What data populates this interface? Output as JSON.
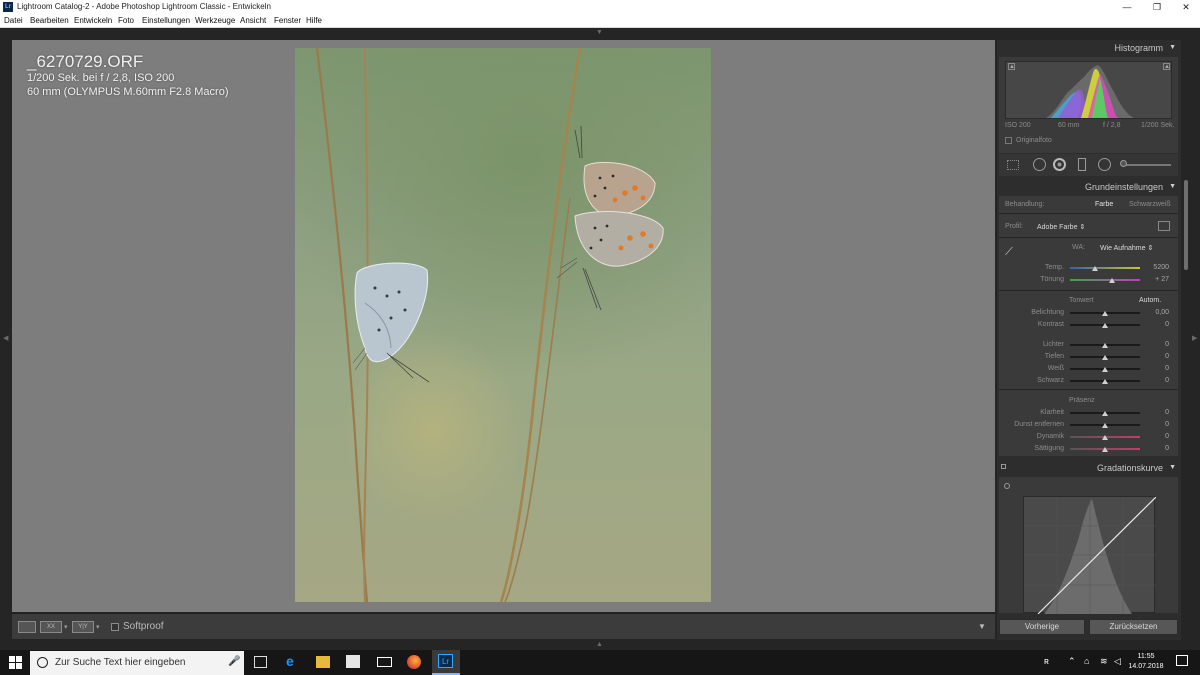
{
  "window": {
    "title": "Lightroom Catalog-2 - Adobe Photoshop Lightroom Classic - Entwickeln",
    "app_badge": "Lr",
    "controls": [
      "—",
      "❐",
      "✕"
    ]
  },
  "menu": [
    "Datei",
    "Bearbeiten",
    "Entwickeln",
    "Foto",
    "Einstellungen",
    "Werkzeuge",
    "Ansicht",
    "Fenster",
    "Hilfe"
  ],
  "photo_info": {
    "filename": "_6270729.ORF",
    "exposure": "1/200 Sek. bei f / 2,8, ISO 200",
    "lens": "60 mm (OLYMPUS M.60mm F2.8 Macro)"
  },
  "toolbar": {
    "view_buttons": [
      "",
      "XX",
      "Y|Y"
    ],
    "softproof_label": "Softproof"
  },
  "histogram": {
    "title": "Histogramm",
    "iso": "ISO 200",
    "focal": "60 mm",
    "aperture": "f / 2,8",
    "shutter": "1/200 Sek.",
    "original_label": "Originalfoto"
  },
  "basic": {
    "title": "Grundeinstellungen",
    "treatment_label": "Behandlung:",
    "treatment_color": "Farbe",
    "treatment_bw": "Schwarzweiß",
    "profile_label": "Profil:",
    "profile_value": "Adobe Farbe",
    "wb_label": "WA:",
    "wb_value": "Wie Aufnahme",
    "temp_label": "Temp.",
    "temp_value": "5200",
    "temp_pos": 0.35,
    "tint_label": "Tönung",
    "tint_value": "+ 27",
    "tint_pos": 0.6,
    "tone_title": "Tonwert",
    "auto_label": "Autom.",
    "exposure_label": "Belichtung",
    "exposure_value": "0,00",
    "contrast_label": "Kontrast",
    "contrast_value": "0",
    "highlights_label": "Lichter",
    "highlights_value": "0",
    "shadows_label": "Tiefen",
    "shadows_value": "0",
    "whites_label": "Weiß",
    "whites_value": "0",
    "blacks_label": "Schwarz",
    "blacks_value": "0",
    "presence_title": "Präsenz",
    "clarity_label": "Klarheit",
    "clarity_value": "0",
    "dehaze_label": "Dunst entfernen",
    "dehaze_value": "0",
    "vibrance_label": "Dynamik",
    "vibrance_value": "0",
    "saturation_label": "Sättigung",
    "saturation_value": "0"
  },
  "curve": {
    "title": "Gradationskurve"
  },
  "buttons": {
    "previous": "Vorherige",
    "reset": "Zurücksetzen"
  },
  "taskbar": {
    "search_placeholder": "Zur Suche Text hier eingeben",
    "lr_badge": "Lr",
    "time": "11:55",
    "date": "14.07.2018"
  },
  "colors": {
    "accent_lr": "#31a8ff",
    "panel_bg": "#3a3a3a",
    "canvas_bg": "#7d7d7d"
  }
}
